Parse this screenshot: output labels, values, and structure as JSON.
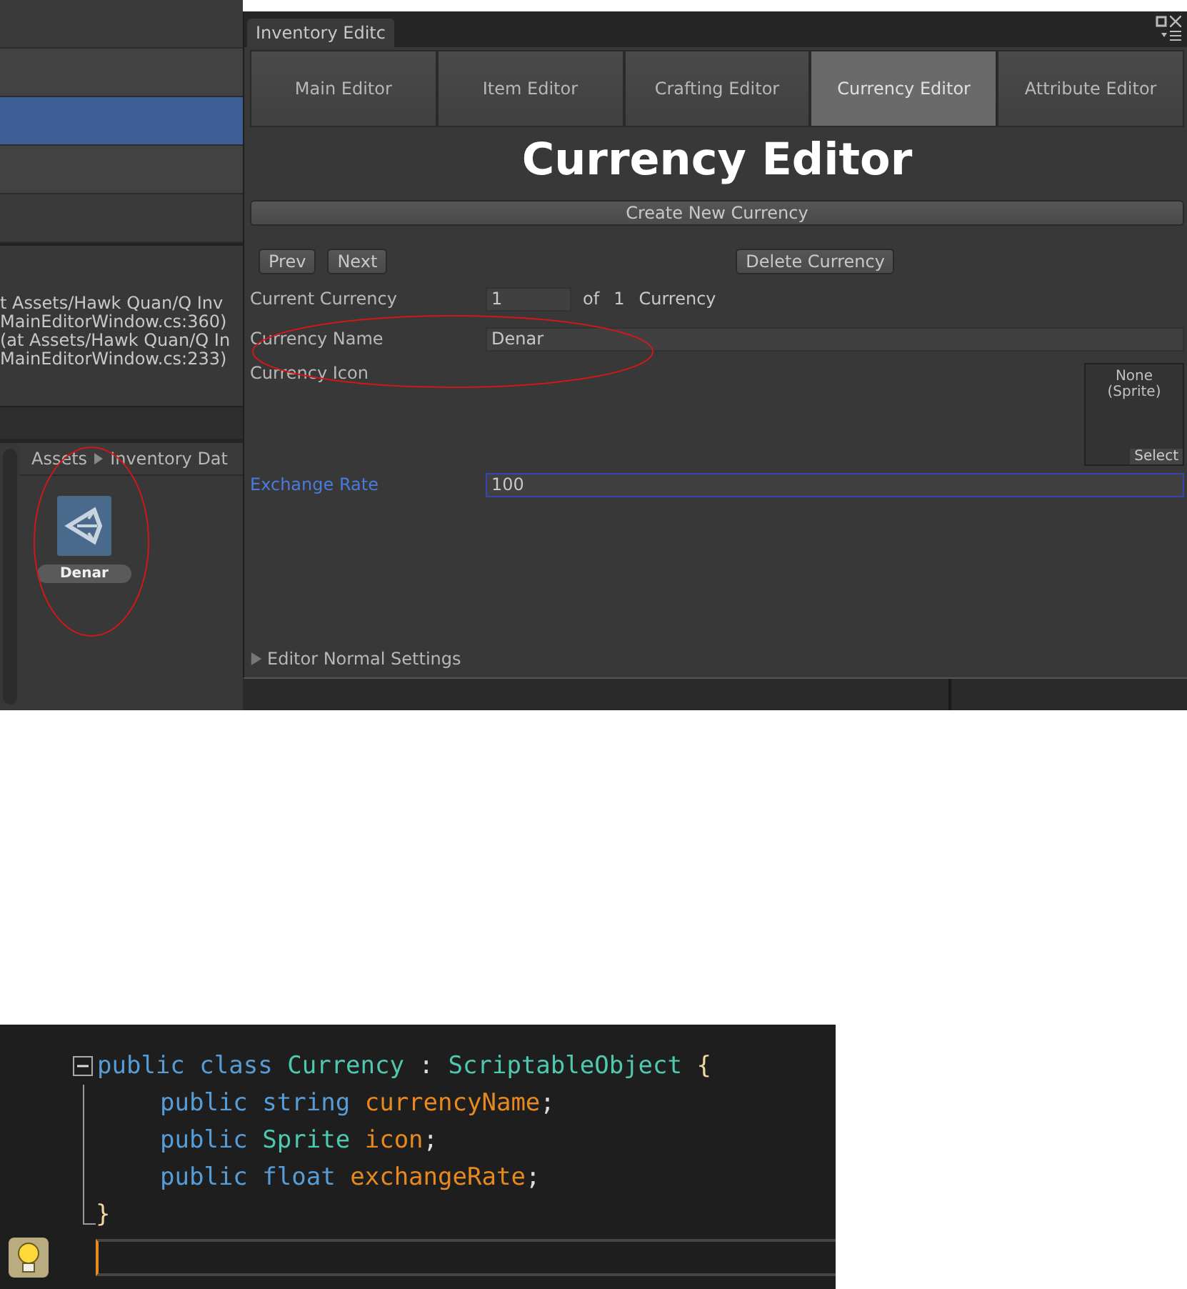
{
  "hierarchy": {
    "rows": [
      {
        "selected": false
      },
      {
        "selected": false
      },
      {
        "selected": true
      },
      {
        "selected": false
      },
      {
        "selected": false
      }
    ]
  },
  "console": {
    "lines": [
      "t Assets/Hawk Quan/Q Inv",
      "MainEditorWindow.cs:360)",
      "(at Assets/Hawk Quan/Q In",
      "MainEditorWindow.cs:233)"
    ]
  },
  "project": {
    "breadcrumb": [
      "Assets",
      "Inventory Dat"
    ],
    "assets": [
      {
        "name": "Denar"
      }
    ]
  },
  "editor": {
    "window_tab": "Inventory Editc",
    "tabs": [
      {
        "label": "Main Editor",
        "selected": false
      },
      {
        "label": "Item Editor",
        "selected": false
      },
      {
        "label": "Crafting Editor",
        "selected": false
      },
      {
        "label": "Currency Editor",
        "selected": true
      },
      {
        "label": "Attribute Editor",
        "selected": false
      }
    ],
    "heading": "Currency Editor",
    "create_button": "Create New Currency",
    "prev_button": "Prev",
    "next_button": "Next",
    "delete_button": "Delete Currency",
    "fields": [
      {
        "kind": "counter",
        "label": "Current Currency",
        "value": "1",
        "of": "of",
        "total": "1",
        "unit": "Currency",
        "focused": false
      },
      {
        "kind": "text",
        "label": "Currency Name",
        "value": "Denar",
        "focused": false
      },
      {
        "kind": "sprite",
        "label": "Currency Icon",
        "preview": "None (Sprite)",
        "button": "Select",
        "focused": false
      },
      {
        "kind": "text",
        "label": "Exchange Rate",
        "value": "100",
        "focused": true
      }
    ],
    "foldout": {
      "label": "Editor Normal Settings",
      "expanded": false
    }
  },
  "code": {
    "collapsed": false,
    "tokens": [
      {
        "text": "public",
        "kind": "keyword"
      },
      {
        "text": "class",
        "kind": "keyword"
      },
      {
        "text": "Currency",
        "kind": "type"
      },
      {
        "text": ":",
        "kind": "operator"
      },
      {
        "text": "ScriptableObject",
        "kind": "type"
      },
      {
        "text": "{",
        "kind": "brace"
      }
    ],
    "children": [
      {
        "tokens": [
          {
            "text": "public",
            "kind": "keyword"
          },
          {
            "text": "string",
            "kind": "keyword"
          },
          {
            "text": "currencyName",
            "kind": "field"
          },
          {
            "text": ";",
            "kind": "terminator"
          }
        ]
      },
      {
        "tokens": [
          {
            "text": "public",
            "kind": "keyword"
          },
          {
            "text": "Sprite",
            "kind": "type"
          },
          {
            "text": "icon",
            "kind": "field"
          },
          {
            "text": ";",
            "kind": "terminator"
          }
        ]
      },
      {
        "tokens": [
          {
            "text": "public",
            "kind": "keyword"
          },
          {
            "text": "float",
            "kind": "keyword"
          },
          {
            "text": "exchangeRate",
            "kind": "field"
          },
          {
            "text": ";",
            "kind": "terminator"
          }
        ]
      }
    ],
    "closing": "}"
  }
}
